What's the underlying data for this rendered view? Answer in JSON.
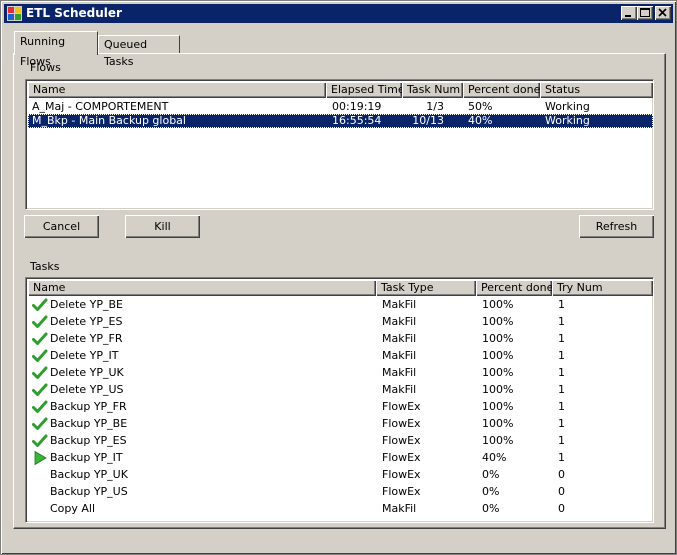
{
  "window": {
    "title": "ETL Scheduler",
    "controls": {
      "minimize": "minimize-icon",
      "maximize": "maximize-icon",
      "close": "close-icon"
    }
  },
  "tabs": [
    {
      "label": "Running Flows",
      "active": true
    },
    {
      "label": "Queued Tasks",
      "active": false
    }
  ],
  "flows": {
    "group_label": "Flows",
    "columns": [
      "Name",
      "Elapsed Time",
      "Task Num",
      "Percent done",
      "Status"
    ],
    "rows": [
      {
        "name": "A_Maj - COMPORTEMENT",
        "elapsed": "00:19:19",
        "task_num": "1/3",
        "percent": "50%",
        "status": "Working",
        "selected": false
      },
      {
        "name": "M_Bkp - Main Backup global",
        "elapsed": "16:55:54",
        "task_num": "10/13",
        "percent": "40%",
        "status": "Working",
        "selected": true
      }
    ]
  },
  "buttons": {
    "cancel": "Cancel",
    "kill": "Kill",
    "refresh": "Refresh"
  },
  "tasks": {
    "group_label": "Tasks",
    "columns": [
      "Name",
      "Task Type",
      "Percent done",
      "Try Num"
    ],
    "rows": [
      {
        "icon": "check-icon",
        "name": "Delete YP_BE",
        "type": "MakFil",
        "percent": "100%",
        "try": "1"
      },
      {
        "icon": "check-icon",
        "name": "Delete YP_ES",
        "type": "MakFil",
        "percent": "100%",
        "try": "1"
      },
      {
        "icon": "check-icon",
        "name": "Delete YP_FR",
        "type": "MakFil",
        "percent": "100%",
        "try": "1"
      },
      {
        "icon": "check-icon",
        "name": "Delete YP_IT",
        "type": "MakFil",
        "percent": "100%",
        "try": "1"
      },
      {
        "icon": "check-icon",
        "name": "Delete YP_UK",
        "type": "MakFil",
        "percent": "100%",
        "try": "1"
      },
      {
        "icon": "check-icon",
        "name": "Delete YP_US",
        "type": "MakFil",
        "percent": "100%",
        "try": "1"
      },
      {
        "icon": "check-icon",
        "name": "Backup YP_FR",
        "type": "FlowEx",
        "percent": "100%",
        "try": "1"
      },
      {
        "icon": "check-icon",
        "name": "Backup YP_BE",
        "type": "FlowEx",
        "percent": "100%",
        "try": "1"
      },
      {
        "icon": "check-icon",
        "name": "Backup YP_ES",
        "type": "FlowEx",
        "percent": "100%",
        "try": "1"
      },
      {
        "icon": "play-icon",
        "name": "Backup YP_IT",
        "type": "FlowEx",
        "percent": "40%",
        "try": "1"
      },
      {
        "icon": "",
        "name": "Backup YP_UK",
        "type": "FlowEx",
        "percent": "0%",
        "try": "0"
      },
      {
        "icon": "",
        "name": "Backup YP_US",
        "type": "FlowEx",
        "percent": "0%",
        "try": "0"
      },
      {
        "icon": "",
        "name": "Copy All",
        "type": "MakFil",
        "percent": "0%",
        "try": "0"
      }
    ]
  },
  "colors": {
    "titlebar": "#0a246a",
    "selection": "#0a246a",
    "face": "#d4d0c8",
    "check": "#2e9e2e",
    "play": "#3cb43c"
  }
}
